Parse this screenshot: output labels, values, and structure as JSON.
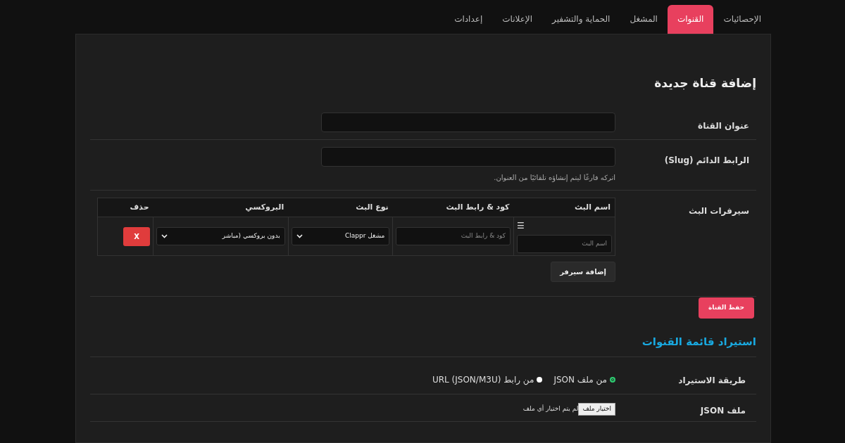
{
  "tabs": [
    {
      "label": "الإحصائيات",
      "selected": false
    },
    {
      "label": "القنوات",
      "selected": true
    },
    {
      "label": "المشغل",
      "selected": false
    },
    {
      "label": "الحماية والتشفير",
      "selected": false
    },
    {
      "label": "الإعلانات",
      "selected": false
    },
    {
      "label": "إعدادات",
      "selected": false
    }
  ],
  "add_channel": {
    "title": "إضافة قناة جديدة",
    "fields": [
      {
        "label": "عنوان القناة"
      },
      {
        "label": "الرابط الدائم (Slug)",
        "help": "اتركه فارغًا ليتم إنشاؤه تلقائيًا من العنوان."
      }
    ],
    "servers": {
      "label": "سيرفرات البث",
      "columns": [
        "اسم البث",
        "كود & رابط البث",
        "نوع البث",
        "البروكسي",
        "حذف"
      ],
      "rows": [
        {
          "handle": "☰",
          "name_placeholder": "اسم البث",
          "code_placeholder": "كود & رابط البث",
          "type": "مشغل Clappr",
          "proxy": "بدون بروكسي (مباشر",
          "delete": "X"
        }
      ],
      "add_button": "إضافة سيرفر"
    },
    "save_button": "حفظ القناة"
  },
  "import": {
    "title": "استيراد قائمة القنوات",
    "method_label": "طريقة الاستيراد",
    "methods": [
      {
        "label": "من ملف JSON",
        "selected": true
      },
      {
        "label": "من رابط (JSON/M3U) URL",
        "selected": false
      }
    ],
    "file_label": "ملف JSON",
    "file_button": "اختيار ملف",
    "file_status": "لم يتم اختيار أي ملف"
  }
}
